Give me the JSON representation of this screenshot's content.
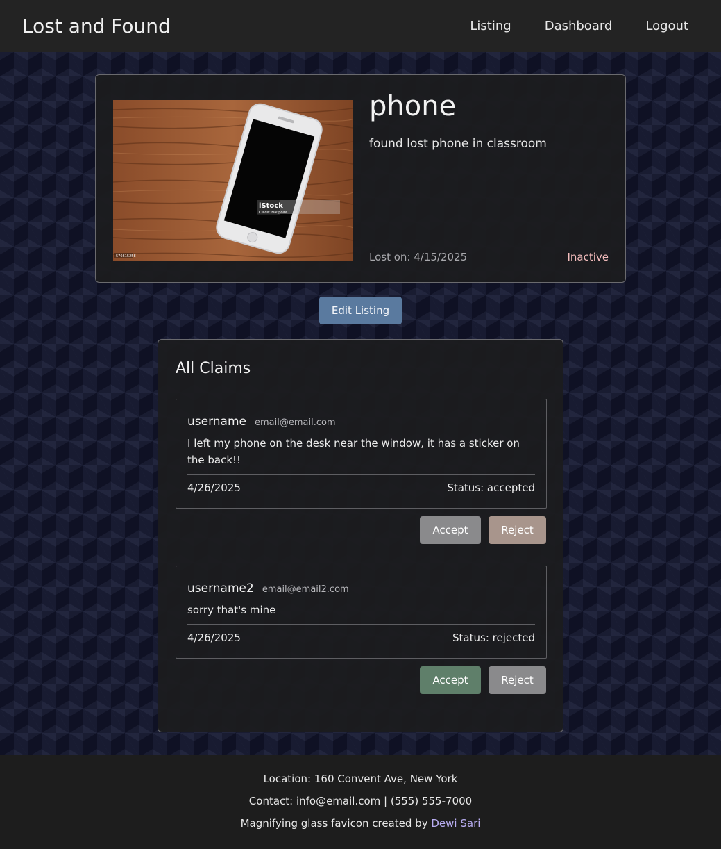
{
  "navbar": {
    "brand": "Lost and Found",
    "links": [
      "Listing",
      "Dashboard",
      "Logout"
    ]
  },
  "listing": {
    "title": "phone",
    "description": "found lost phone in classroom",
    "lost_on": "Lost on: 4/15/2025",
    "status": "Inactive",
    "status_color": "#f3bcbc",
    "photo_watermark": "iStock",
    "photo_credit": "Credit: Halfpoint",
    "photo_id": "576615258"
  },
  "edit_button": "Edit Listing",
  "claims": {
    "title": "All Claims",
    "items": [
      {
        "username": "username",
        "email": "email@email.com",
        "message": "I left my phone on the desk near the window, it has a sticker on the back!!",
        "date": "4/26/2025",
        "status": "Status: accepted",
        "accept_label": "Accept",
        "reject_label": "Reject",
        "accept_color": "#8a8a8c",
        "reject_color": "#a8958c"
      },
      {
        "username": "username2",
        "email": "email@email2.com",
        "message": "sorry that's mine",
        "date": "4/26/2025",
        "status": "Status: rejected",
        "accept_label": "Accept",
        "reject_label": "Reject",
        "accept_color": "#5f7f6a",
        "reject_color": "#8a8a8c"
      }
    ]
  },
  "footer": {
    "location": "Location: 160 Convent Ave, New York",
    "contact": "Contact: info@email.com | (555) 555-7000",
    "credit_prefix": "Magnifying glass favicon created by",
    "credit_link": "Dewi Sari"
  }
}
